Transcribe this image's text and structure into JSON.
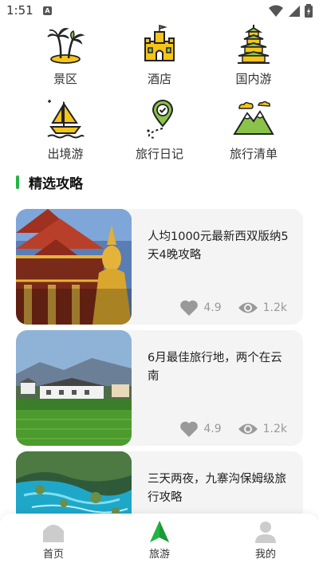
{
  "status": {
    "time": "1:51",
    "notification_letter": "A"
  },
  "categories": [
    {
      "label": "景区",
      "icon": "palm-island-icon"
    },
    {
      "label": "酒店",
      "icon": "castle-hotel-icon"
    },
    {
      "label": "国内游",
      "icon": "pagoda-icon"
    },
    {
      "label": "出境游",
      "icon": "sailboat-icon"
    },
    {
      "label": "旅行日记",
      "icon": "map-pin-check-icon"
    },
    {
      "label": "旅行清单",
      "icon": "mountain-icon"
    }
  ],
  "section": {
    "title": "精选攻略"
  },
  "articles": [
    {
      "title": "人均1000元最新西双版纳5天4晚攻略",
      "likes": "4.9",
      "views": "1.2k"
    },
    {
      "title": "6月最佳旅行地，两个在云南",
      "likes": "4.9",
      "views": "1.2k"
    },
    {
      "title": "三天两夜，九寨沟保姆级旅行攻略",
      "likes": "",
      "views": ""
    }
  ],
  "tabs": [
    {
      "label": "首页",
      "icon": "home-icon"
    },
    {
      "label": "旅游",
      "icon": "travel-triangle-icon"
    },
    {
      "label": "我的",
      "icon": "user-icon"
    }
  ],
  "colors": {
    "accent": "#22b544",
    "icon_yellow": "#f5c518",
    "icon_green": "#8bc34a",
    "card_bg": "#f4f4f4"
  }
}
